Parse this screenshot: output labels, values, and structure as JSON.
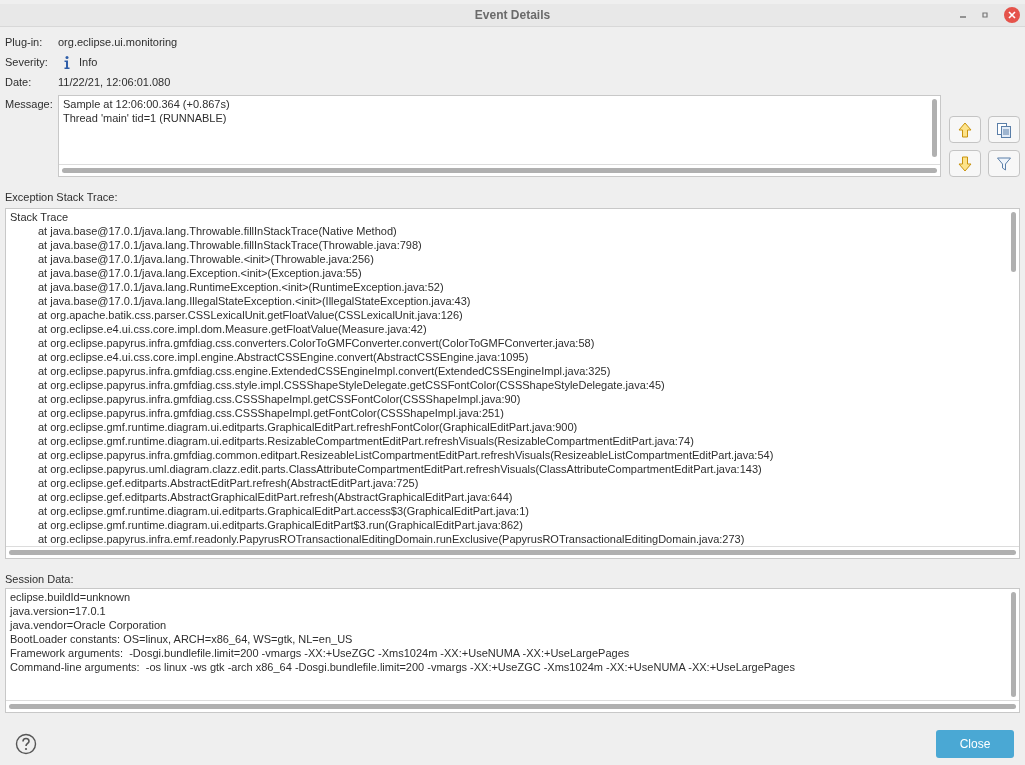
{
  "window": {
    "title": "Event Details"
  },
  "fields": [
    {
      "label": "Plug-in:",
      "value": "org.eclipse.ui.monitoring",
      "kind": "text"
    },
    {
      "label": "Severity:",
      "value": "Info",
      "kind": "severity"
    },
    {
      "label": "Date:",
      "value": "11/22/21, 12:06:01.080",
      "kind": "text"
    }
  ],
  "message": {
    "label": "Message:",
    "lines": [
      "Sample at 12:06:00.364 (+0.867s)",
      "Thread 'main' tid=1 (RUNNABLE)"
    ]
  },
  "stack_trace": {
    "label": "Exception Stack Trace:",
    "header": "Stack Trace",
    "lines": [
      "at java.base@17.0.1/java.lang.Throwable.fillInStackTrace(Native Method)",
      "at java.base@17.0.1/java.lang.Throwable.fillInStackTrace(Throwable.java:798)",
      "at java.base@17.0.1/java.lang.Throwable.<init>(Throwable.java:256)",
      "at java.base@17.0.1/java.lang.Exception.<init>(Exception.java:55)",
      "at java.base@17.0.1/java.lang.RuntimeException.<init>(RuntimeException.java:52)",
      "at java.base@17.0.1/java.lang.IllegalStateException.<init>(IllegalStateException.java:43)",
      "at org.apache.batik.css.parser.CSSLexicalUnit.getFloatValue(CSSLexicalUnit.java:126)",
      "at org.eclipse.e4.ui.css.core.impl.dom.Measure.getFloatValue(Measure.java:42)",
      "at org.eclipse.papyrus.infra.gmfdiag.css.converters.ColorToGMFConverter.convert(ColorToGMFConverter.java:58)",
      "at org.eclipse.e4.ui.css.core.impl.engine.AbstractCSSEngine.convert(AbstractCSSEngine.java:1095)",
      "at org.eclipse.papyrus.infra.gmfdiag.css.engine.ExtendedCSSEngineImpl.convert(ExtendedCSSEngineImpl.java:325)",
      "at org.eclipse.papyrus.infra.gmfdiag.css.style.impl.CSSShapeStyleDelegate.getCSSFontColor(CSSShapeStyleDelegate.java:45)",
      "at org.eclipse.papyrus.infra.gmfdiag.css.CSSShapeImpl.getCSSFontColor(CSSShapeImpl.java:90)",
      "at org.eclipse.papyrus.infra.gmfdiag.css.CSSShapeImpl.getFontColor(CSSShapeImpl.java:251)",
      "at org.eclipse.gmf.runtime.diagram.ui.editparts.GraphicalEditPart.refreshFontColor(GraphicalEditPart.java:900)",
      "at org.eclipse.gmf.runtime.diagram.ui.editparts.ResizableCompartmentEditPart.refreshVisuals(ResizableCompartmentEditPart.java:74)",
      "at org.eclipse.papyrus.infra.gmfdiag.common.editpart.ResizeableListCompartmentEditPart.refreshVisuals(ResizeableListCompartmentEditPart.java:54)",
      "at org.eclipse.papyrus.uml.diagram.clazz.edit.parts.ClassAttributeCompartmentEditPart.refreshVisuals(ClassAttributeCompartmentEditPart.java:143)",
      "at org.eclipse.gef.editparts.AbstractEditPart.refresh(AbstractEditPart.java:725)",
      "at org.eclipse.gef.editparts.AbstractGraphicalEditPart.refresh(AbstractGraphicalEditPart.java:644)",
      "at org.eclipse.gmf.runtime.diagram.ui.editparts.GraphicalEditPart.access$3(GraphicalEditPart.java:1)",
      "at org.eclipse.gmf.runtime.diagram.ui.editparts.GraphicalEditPart$3.run(GraphicalEditPart.java:862)",
      "at org.eclipse.papyrus.infra.emf.readonly.PapyrusROTransactionalEditingDomain.runExclusive(PapyrusROTransactionalEditingDomain.java:273)"
    ]
  },
  "session_data": {
    "label": "Session Data:",
    "lines": [
      "eclipse.buildId=unknown",
      "java.version=17.0.1",
      "java.vendor=Oracle Corporation",
      "BootLoader constants: OS=linux, ARCH=x86_64, WS=gtk, NL=en_US",
      "Framework arguments:  -Dosgi.bundlefile.limit=200 -vmargs -XX:+UseZGC -Xms1024m -XX:+UseNUMA -XX:+UseLargePages",
      "Command-line arguments:  -os linux -ws gtk -arch x86_64 -Dosgi.bundlefile.limit=200 -vmargs -XX:+UseZGC -Xms1024m -XX:+UseNUMA -XX:+UseLargePages"
    ]
  },
  "buttons": {
    "close": "Close"
  }
}
